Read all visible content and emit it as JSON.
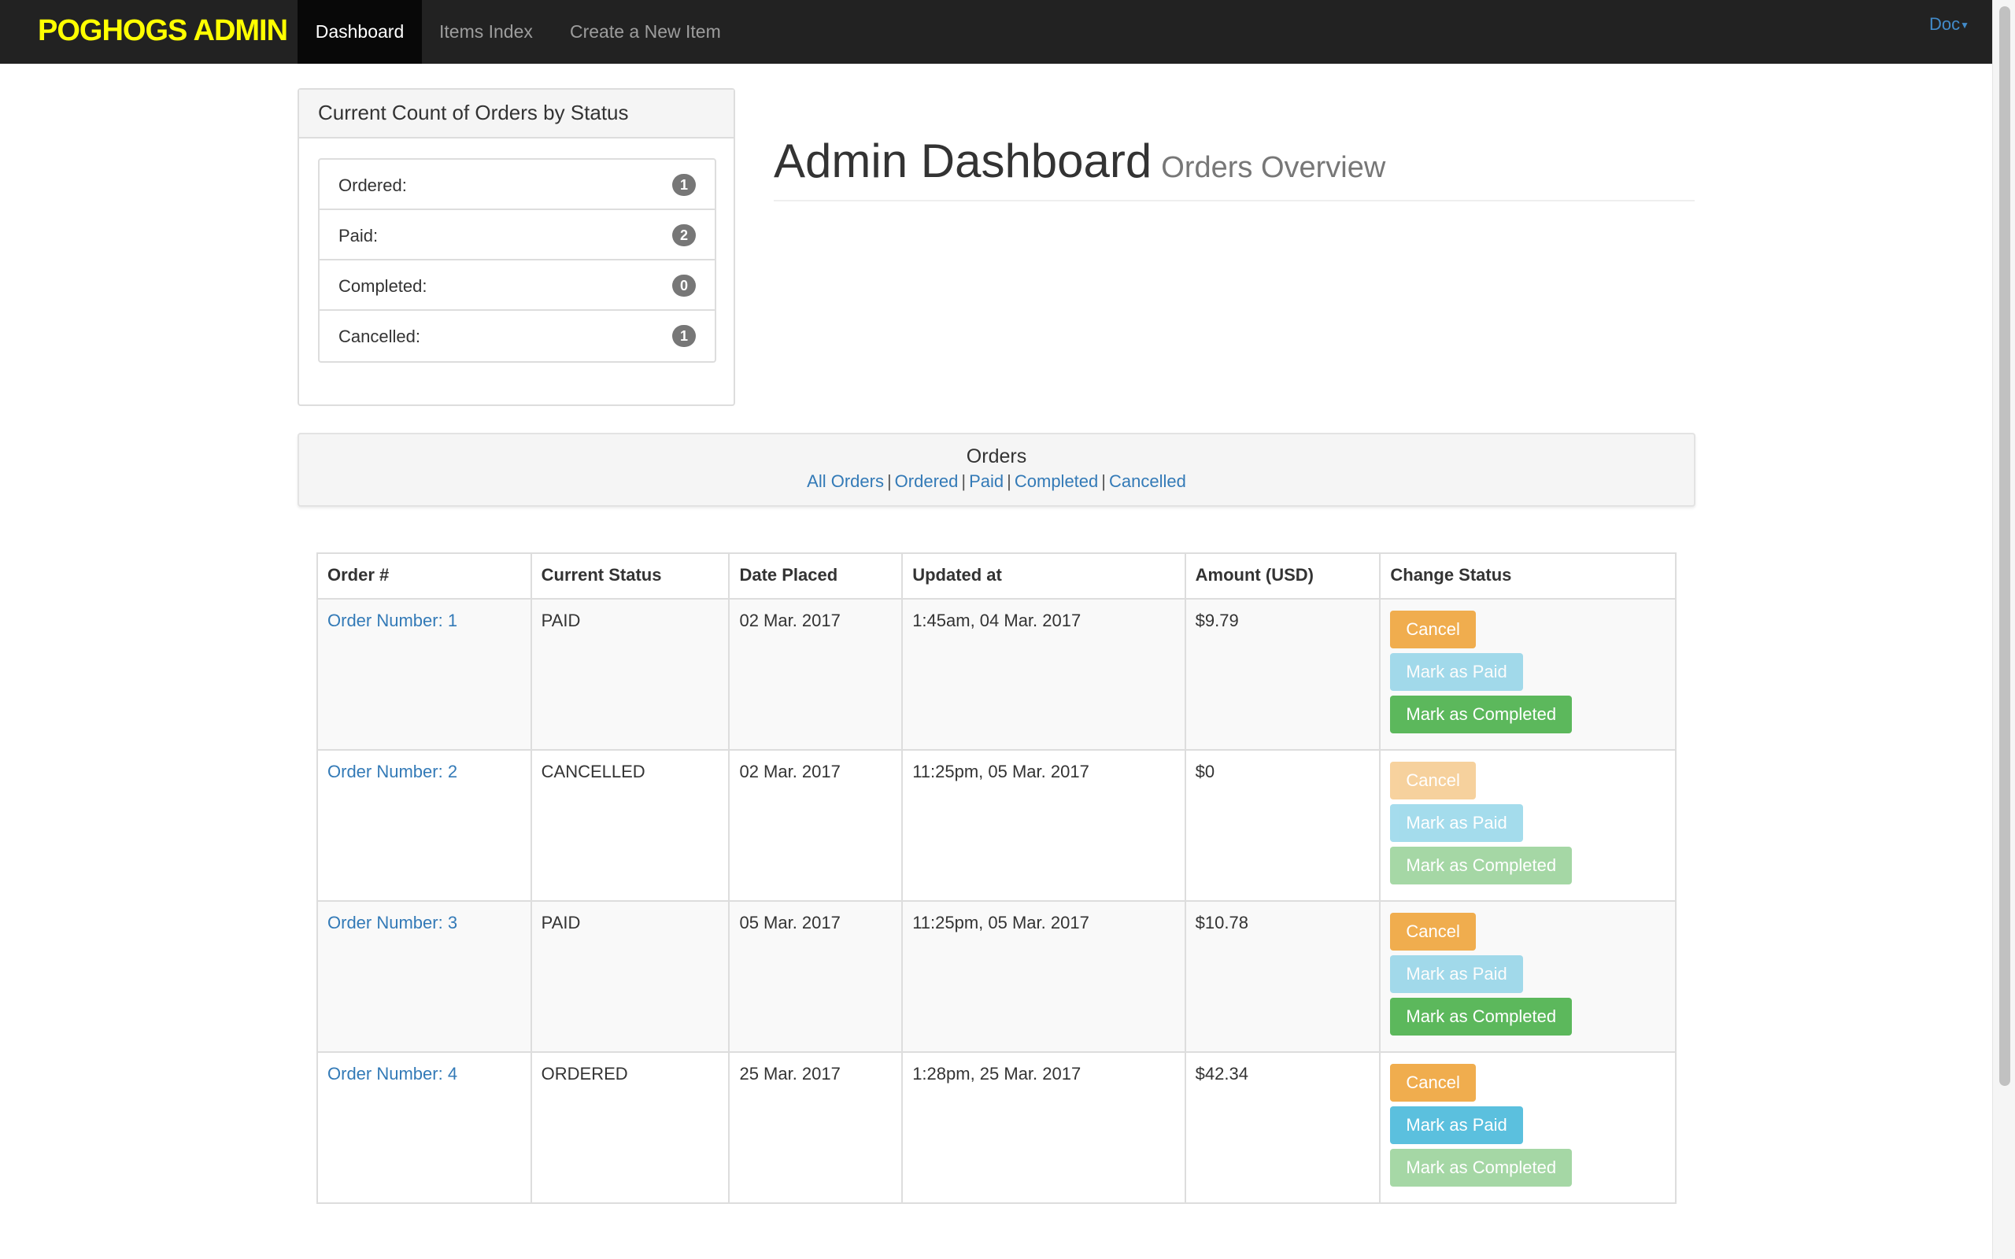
{
  "nav": {
    "brand": "POGHOGS ADMIN",
    "items": [
      {
        "label": "Dashboard",
        "active": true
      },
      {
        "label": "Items Index",
        "active": false
      },
      {
        "label": "Create a New Item",
        "active": false
      }
    ],
    "user_menu": "Doc"
  },
  "status_panel": {
    "title": "Current Count of Orders by Status",
    "items": [
      {
        "label": "Ordered:",
        "count": "1"
      },
      {
        "label": "Paid:",
        "count": "2"
      },
      {
        "label": "Completed:",
        "count": "0"
      },
      {
        "label": "Cancelled:",
        "count": "1"
      }
    ]
  },
  "header": {
    "title": "Admin Dashboard",
    "subtitle": "Orders Overview"
  },
  "orders_filter": {
    "title": "Orders",
    "links": [
      "All Orders",
      "Ordered",
      "Paid",
      "Completed",
      "Cancelled"
    ],
    "separator": "|"
  },
  "table": {
    "headers": [
      "Order #",
      "Current Status",
      "Date Placed",
      "Updated at",
      "Amount (USD)",
      "Change Status"
    ],
    "buttons": {
      "cancel": "Cancel",
      "paid": "Mark as Paid",
      "complete": "Mark as Completed"
    },
    "rows": [
      {
        "order": "Order Number: 1",
        "status": "PAID",
        "date": "02 Mar. 2017",
        "updated": "1:45am, 04 Mar. 2017",
        "amount": "$9.79"
      },
      {
        "order": "Order Number: 2",
        "status": "CANCELLED",
        "date": "02 Mar. 2017",
        "updated": "11:25pm, 05 Mar. 2017",
        "amount": "$0"
      },
      {
        "order": "Order Number: 3",
        "status": "PAID",
        "date": "05 Mar. 2017",
        "updated": "11:25pm, 05 Mar. 2017",
        "amount": "$10.78"
      },
      {
        "order": "Order Number: 4",
        "status": "ORDERED",
        "date": "25 Mar. 2017",
        "updated": "1:28pm, 25 Mar. 2017",
        "amount": "$42.34"
      }
    ]
  },
  "colors": {
    "navbar": "#222222",
    "brand": "#ffff00",
    "link": "#337ab7",
    "warning": "#f0ad4e",
    "info": "#5bc0de",
    "success": "#5cb85c"
  }
}
